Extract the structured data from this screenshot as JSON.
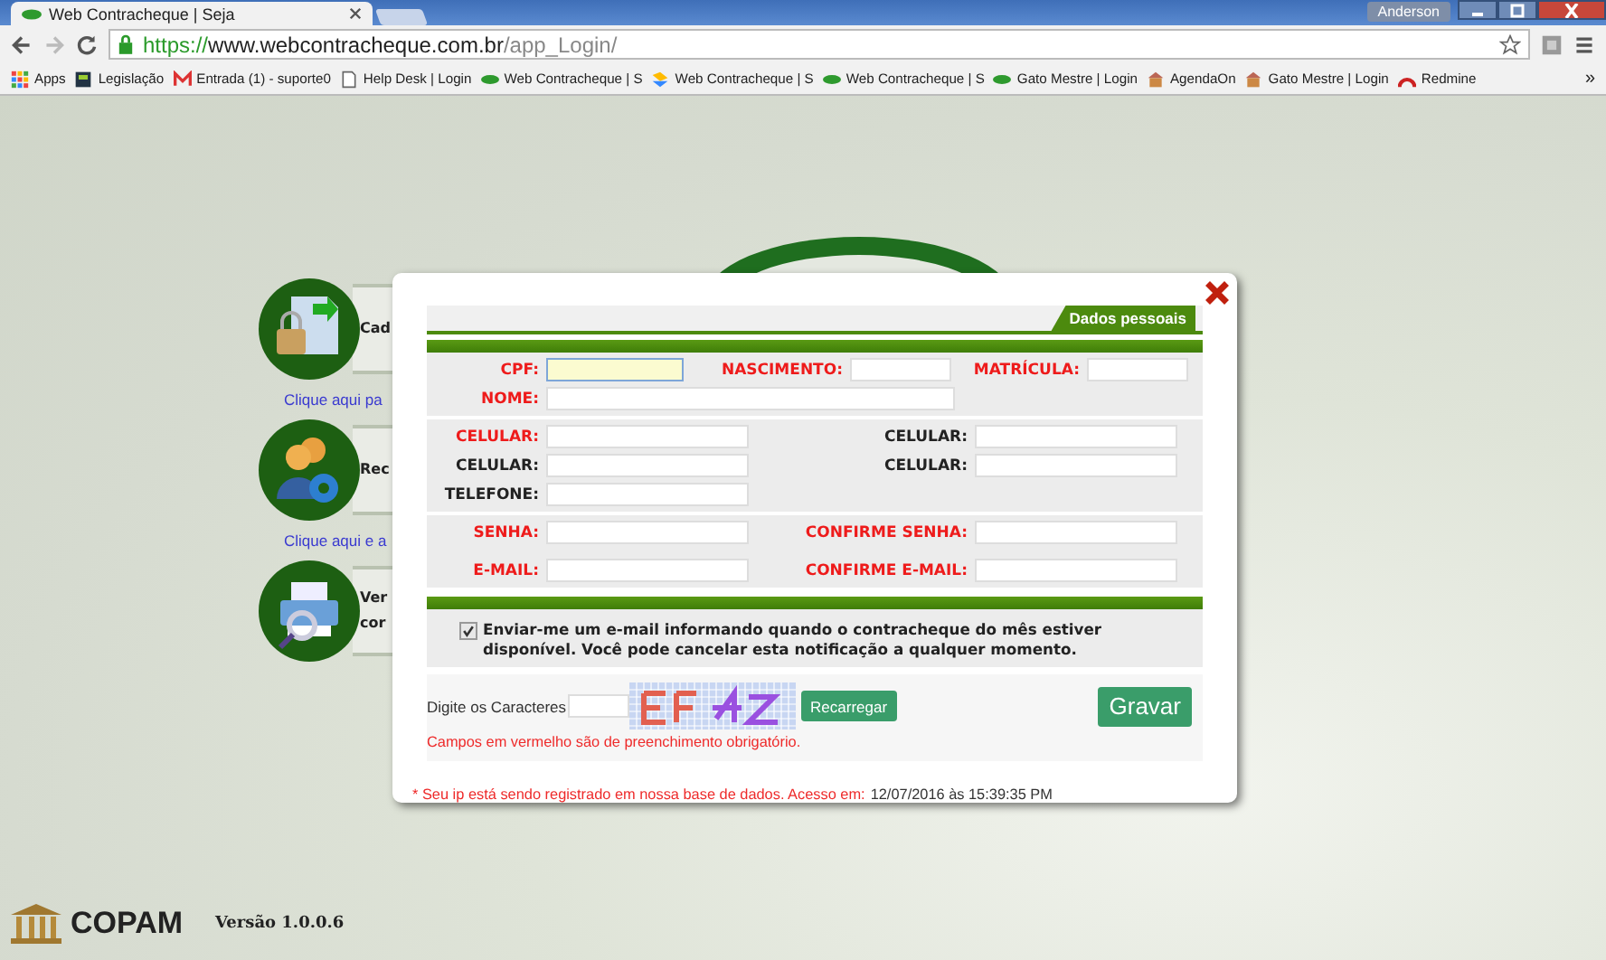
{
  "browser": {
    "tab_title": "Web Contracheque | Seja",
    "user": "Anderson",
    "url": {
      "scheme": "https://",
      "host": "www.webcontracheque.com.br",
      "path": "/app_Login/"
    },
    "bookmarks": [
      {
        "label": "Apps",
        "kind": "apps"
      },
      {
        "label": "Legislação",
        "kind": "book"
      },
      {
        "label": "Entrada (1) - suporte0",
        "kind": "mail"
      },
      {
        "label": "Help Desk | Login",
        "kind": "page"
      },
      {
        "label": "Web Contracheque | S",
        "kind": "leaf"
      },
      {
        "label": "Web Contracheque | S",
        "kind": "arrow"
      },
      {
        "label": "Web Contracheque | S",
        "kind": "leaf"
      },
      {
        "label": "Gato Mestre | Login",
        "kind": "leaf"
      },
      {
        "label": "AgendaOn",
        "kind": "house"
      },
      {
        "label": "Gato Mestre | Login",
        "kind": "house"
      },
      {
        "label": "Redmine",
        "kind": "arc"
      }
    ],
    "overflow": "»"
  },
  "page": {
    "menu": [
      {
        "kind": "lock",
        "lines": [
          "Cad"
        ],
        "link": "Clique aqui pa"
      },
      {
        "kind": "people",
        "lines": [
          "Rec"
        ],
        "link": "Clique aqui e a"
      },
      {
        "kind": "printer",
        "lines": [
          "Ver",
          "cor"
        ]
      }
    ],
    "footer": {
      "brand": "COPAM",
      "version": "Versão 1.0.0.6"
    }
  },
  "dialog": {
    "tab": "Dados pessoais",
    "sections": [
      {
        "rows": [
          {
            "kind": "triple",
            "fields": [
              {
                "label": "CPF:",
                "required": true,
                "focused": true
              },
              {
                "label": "NASCIMENTO:",
                "required": true,
                "focused": false
              },
              {
                "label": "MATRÍCULA:",
                "required": true,
                "focused": false
              }
            ]
          },
          {
            "kind": "single",
            "fields": [
              {
                "label": "NOME:",
                "required": true,
                "focused": false
              }
            ]
          }
        ]
      },
      {
        "rows": [
          {
            "kind": "pair",
            "fields": [
              {
                "label": "CELULAR:",
                "required": true,
                "focused": false
              },
              {
                "label": "CELULAR:",
                "required": false,
                "focused": false
              }
            ]
          },
          {
            "kind": "pair",
            "fields": [
              {
                "label": "CELULAR:",
                "required": false,
                "focused": false
              },
              {
                "label": "CELULAR:",
                "required": false,
                "focused": false
              }
            ]
          },
          {
            "kind": "pair",
            "fields": [
              {
                "label": "TELEFONE:",
                "required": false,
                "focused": false
              }
            ]
          }
        ]
      },
      {
        "rows": [
          {
            "kind": "pair",
            "fields": [
              {
                "label": "SENHA:",
                "required": true,
                "focused": false
              },
              {
                "label": "CONFIRME SENHA:",
                "required": true,
                "focused": false
              }
            ]
          },
          {
            "kind": "pair",
            "fields": [
              {
                "label": "E-MAIL:",
                "required": true,
                "focused": false
              },
              {
                "label": "CONFIRME E-MAIL:",
                "required": true,
                "focused": false
              }
            ]
          }
        ]
      }
    ],
    "notify": {
      "checked": true,
      "text": "Enviar-me um e-mail informando quando o contracheque do mês estiver disponível. Você pode cancelar esta notificação a qualquer momento."
    },
    "captcha": {
      "label": "Digite os Caracteres",
      "reload": "Recarregar"
    },
    "submit": "Gravar",
    "required_note": "Campos em vermelho são de preenchimento obrigatório.",
    "ip_note": {
      "text": "* Seu ip está sendo registrado em nossa base de dados. Acesso em:",
      "timestamp": "12/07/2016 às 15:39:35 PM"
    }
  }
}
